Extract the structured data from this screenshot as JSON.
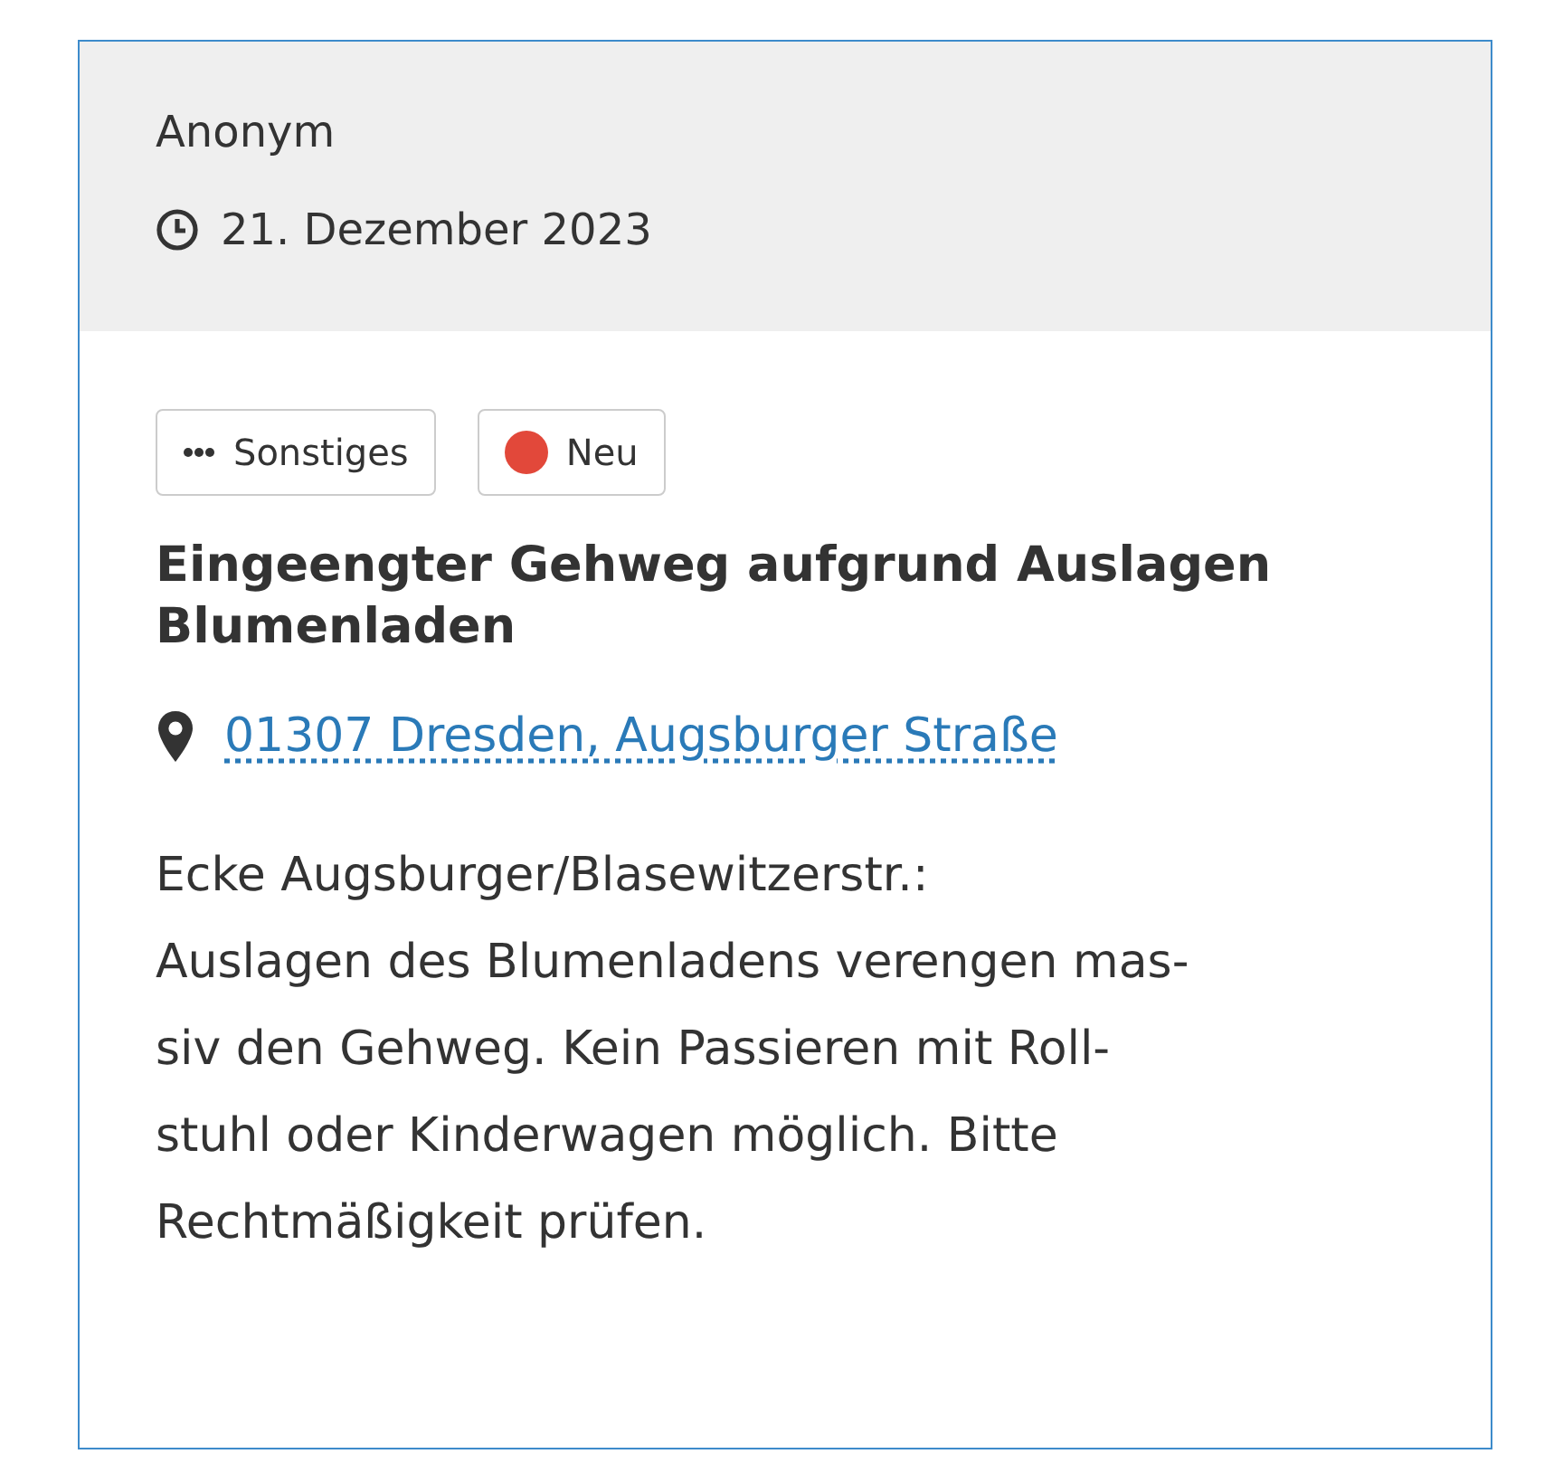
{
  "report": {
    "author": "Anonym",
    "date": "21. Dezember 2023",
    "tags": [
      {
        "kind": "category",
        "label": "Sonstiges"
      },
      {
        "kind": "status",
        "label": "Neu",
        "color": "#e2483a"
      }
    ],
    "title": "Eingeengter Gehweg aufgrund Auslagen Blumenladen",
    "location": "01307 Dresden, Augsburger Straße",
    "description": "Ecke Augsburger/Blasewitzerstr.:\nAuslagen des Blumenladens verengen mas-\nsiv den Gehweg. Kein Passieren mit Roll-\nstuhl oder Kinderwagen möglich. Bitte\nRechtmäßigkeit prüfen."
  }
}
